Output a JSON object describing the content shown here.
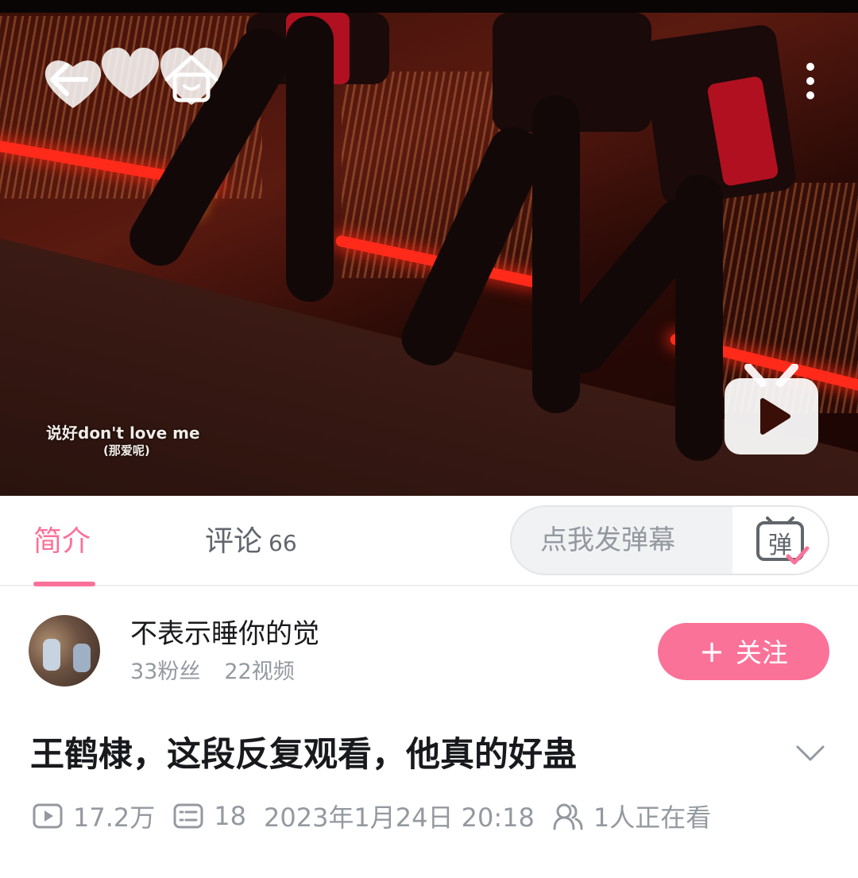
{
  "video": {
    "caption_line1": "说好don't love me",
    "caption_line2": "(那爱呢)"
  },
  "tabs": {
    "intro_label": "简介",
    "comments_label": "评论",
    "comments_count": "66"
  },
  "danmaku": {
    "placeholder": "点我发弹幕",
    "button_glyph": "弹"
  },
  "uploader": {
    "name": "不表示睡你的觉",
    "fans": "33粉丝",
    "videos": "22视频",
    "follow_label": "关注"
  },
  "title": "王鹤棣，这段反复观看，他真的好蛊",
  "meta": {
    "plays": "17.2万",
    "danmaku_count": "18",
    "datetime": "2023年1月24日 20:18",
    "watching": "1人正在看"
  },
  "colors": {
    "accent": "#fb7299",
    "text_primary": "#18191c",
    "text_secondary": "#9499a0"
  },
  "icons": [
    "back-arrow-icon",
    "heart-icon",
    "home-icon",
    "more-vertical-icon",
    "tv-play-icon",
    "danmaku-icon",
    "chevron-down-icon",
    "play-count-icon",
    "danmaku-count-icon",
    "viewers-icon"
  ]
}
